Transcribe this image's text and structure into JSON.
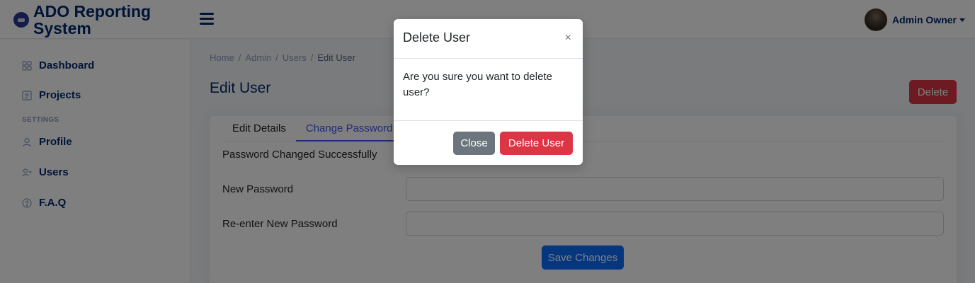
{
  "app": {
    "title": "ADO Reporting System"
  },
  "header": {
    "user_name": "Admin Owner"
  },
  "sidebar": {
    "items": [
      {
        "label": "Dashboard",
        "icon": "grid-icon"
      },
      {
        "label": "Projects",
        "icon": "layout-text-icon"
      }
    ],
    "settings_heading": "SETTINGS",
    "settings_items": [
      {
        "label": "Profile",
        "icon": "person-icon"
      },
      {
        "label": "Users",
        "icon": "person-plus-icon"
      },
      {
        "label": "F.A.Q",
        "icon": "question-circle-icon"
      }
    ]
  },
  "breadcrumb": {
    "items": [
      "Home",
      "Admin",
      "Users",
      "Edit User"
    ],
    "separator": "/"
  },
  "page": {
    "title": "Edit User",
    "delete_label": "Delete"
  },
  "card": {
    "tabs": [
      {
        "label": "Edit Details",
        "active": false
      },
      {
        "label": "Change Password",
        "active": true
      }
    ],
    "status_message": "Password Changed Successfully",
    "fields": [
      {
        "label": "New Password",
        "value": ""
      },
      {
        "label": "Re-enter New Password",
        "value": ""
      }
    ],
    "save_label": "Save Changes"
  },
  "modal": {
    "title": "Delete User",
    "close_glyph": "×",
    "body": "Are you sure you want to delete user?",
    "close_label": "Close",
    "confirm_label": "Delete User"
  },
  "colors": {
    "brand": "#012970",
    "primary": "#0d6efd",
    "danger": "#dc3545",
    "secondary": "#6c757d",
    "tab_active": "#4154f1"
  }
}
